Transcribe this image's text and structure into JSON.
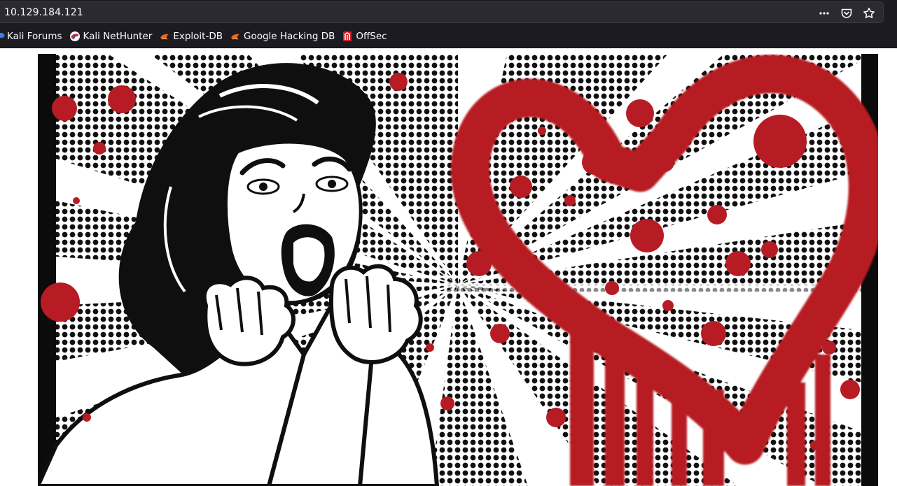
{
  "browser": {
    "url": "10.129.184.121",
    "actions": {
      "more_icon": "more-horizontal-icon",
      "pocket_icon": "pocket-icon",
      "bookmark_icon": "star-icon"
    }
  },
  "bookmarks": [
    {
      "label": "Kali Forums",
      "icon": "kali-dragon-icon"
    },
    {
      "label": "Kali NetHunter",
      "icon": "nethunter-icon"
    },
    {
      "label": "Exploit-DB",
      "icon": "exploitdb-icon"
    },
    {
      "label": "Google Hacking DB",
      "icon": "ghdb-icon"
    },
    {
      "label": "OffSec",
      "icon": "offsec-icon"
    }
  ],
  "hero_image": {
    "subject": "pop-art-screaming-woman-with-bleeding-heart",
    "colors": {
      "red": "#b71c24",
      "black": "#0b0b0b",
      "white": "#ffffff"
    }
  }
}
